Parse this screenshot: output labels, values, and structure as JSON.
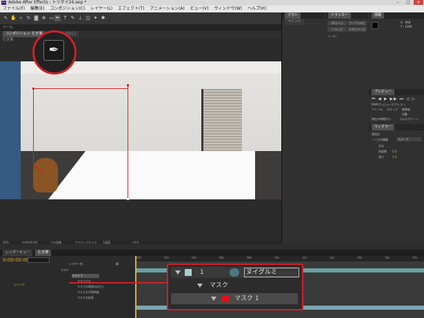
{
  "window": {
    "title": "Adobe After Effects - トリダイ24.aep *",
    "app_badge": "Ae"
  },
  "menu": [
    "ファイル(F)",
    "編集(E)",
    "コンポジション(C)",
    "レイヤー(L)",
    "エフェクト(T)",
    "アニメーション(A)",
    "ビュー(V)",
    "ウィンドウ(W)",
    "ヘルプ(H)"
  ],
  "tools": [
    "arrow-icon",
    "hand-icon",
    "zoom-icon",
    "rotate-icon",
    "camera-icon",
    "pan-icon",
    "rect-icon",
    "pen-icon",
    "type-icon",
    "brush-icon",
    "clone-icon",
    "eraser-icon",
    "roto-icon",
    "puppet-icon"
  ],
  "viewer": {
    "header_label": "ツール",
    "tabs": [
      "コンポジション: むき薄",
      "レイヤー: (なし)"
    ],
    "sub_label": "むき薄",
    "bottom_zoom": "50%",
    "bottom_time": "0:00:00:00",
    "bottom_quality": "フル画質",
    "bottom_camera": "アクティブカメラ",
    "bottom_views": "1画面",
    "bottom_exposure": "+0.0"
  },
  "panels": {
    "brush_tab": "ブラシ",
    "paint_tab": "ペイント",
    "tracker_tab": "トラッカー",
    "info_tab": "情報",
    "info_x": "X : 968",
    "info_y": "Y : 1260",
    "preview_tab": "プレビュー",
    "preview_label": "RAMプレビューオプション",
    "preview_frame": "フレーム",
    "preview_skip": "スキップ",
    "preview_res": "解像度",
    "preview_auto": "自動",
    "preview_current": "現在の時間から",
    "preview_full": "フルスクリーン",
    "wiggle_tab": "ウィグラー",
    "wiggle_apply": "適用先",
    "wiggle_kind": "ノイズの種類",
    "wiggle_kind_value": "スムーズ",
    "wiggle_dim": "次元",
    "wiggle_freq": "周波数",
    "wiggle_freq_value": "5.0",
    "wiggle_mag": "強さ",
    "wiggle_mag_value": "1.0",
    "tracker_buttons": [
      "3Dカメラ",
      "ワープスタビ",
      "トラック",
      "スタビライズ"
    ],
    "tracker_source": "ソース :"
  },
  "timeline": {
    "tabs": [
      "レンダーキュー",
      "むき薄"
    ],
    "timecode": "0:00:00:00",
    "layer_header": "レイヤー名",
    "mode_header": "親",
    "mode_value": "なし",
    "rows": [
      "マスク",
      "マスク 1",
      "マスクパス",
      "マスクの境界のぼかし",
      "マスクの不透明度",
      "マスクの拡張",
      "ジャンプ"
    ],
    "ruler": [
      "00s",
      "02s",
      "04s",
      "06s",
      "08s",
      "10s",
      "12s",
      "14s",
      "16s",
      "18s",
      "20s"
    ]
  },
  "zoom": {
    "row1_num": "1",
    "row1_name": "ヌイグルミ",
    "row2_label": "マスク",
    "row3_label": "マスク 1"
  },
  "colors": {
    "accent": "#d0202a",
    "timecode": "#e0b030"
  }
}
